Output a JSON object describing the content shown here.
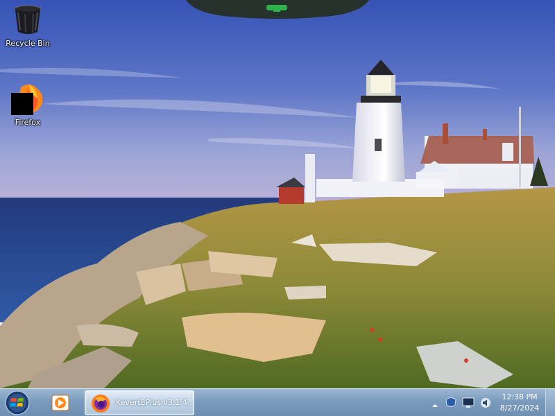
{
  "desktop": {
    "icons": [
      {
        "label": "Recycle Bin",
        "icon": "recycle-bin-icon"
      },
      {
        "label": "Firefox",
        "icon": "firefox-icon"
      }
    ],
    "wallpaper": "lighthouse-coast"
  },
  "taskbar": {
    "start_icon": "windows-start-orb",
    "pinned": [
      {
        "icon": "media-player-icon"
      }
    ],
    "active_window": {
      "icon": "firefox-icon",
      "title": "Kevert8Plus v3.1.4..."
    },
    "tray_icons": [
      "show-hidden-icons-arrow",
      "security-shield-icon",
      "network-monitor-icon",
      "volume-icon"
    ],
    "clock": {
      "time": "12:38 PM",
      "date": "8/27/2024"
    }
  },
  "colors": {
    "taskbar_top": "#9db8d2",
    "taskbar_bottom": "#6e8fb2",
    "sky_top": "#3a58b8",
    "sea": "#24448a",
    "grass": "#8e8a3c"
  }
}
